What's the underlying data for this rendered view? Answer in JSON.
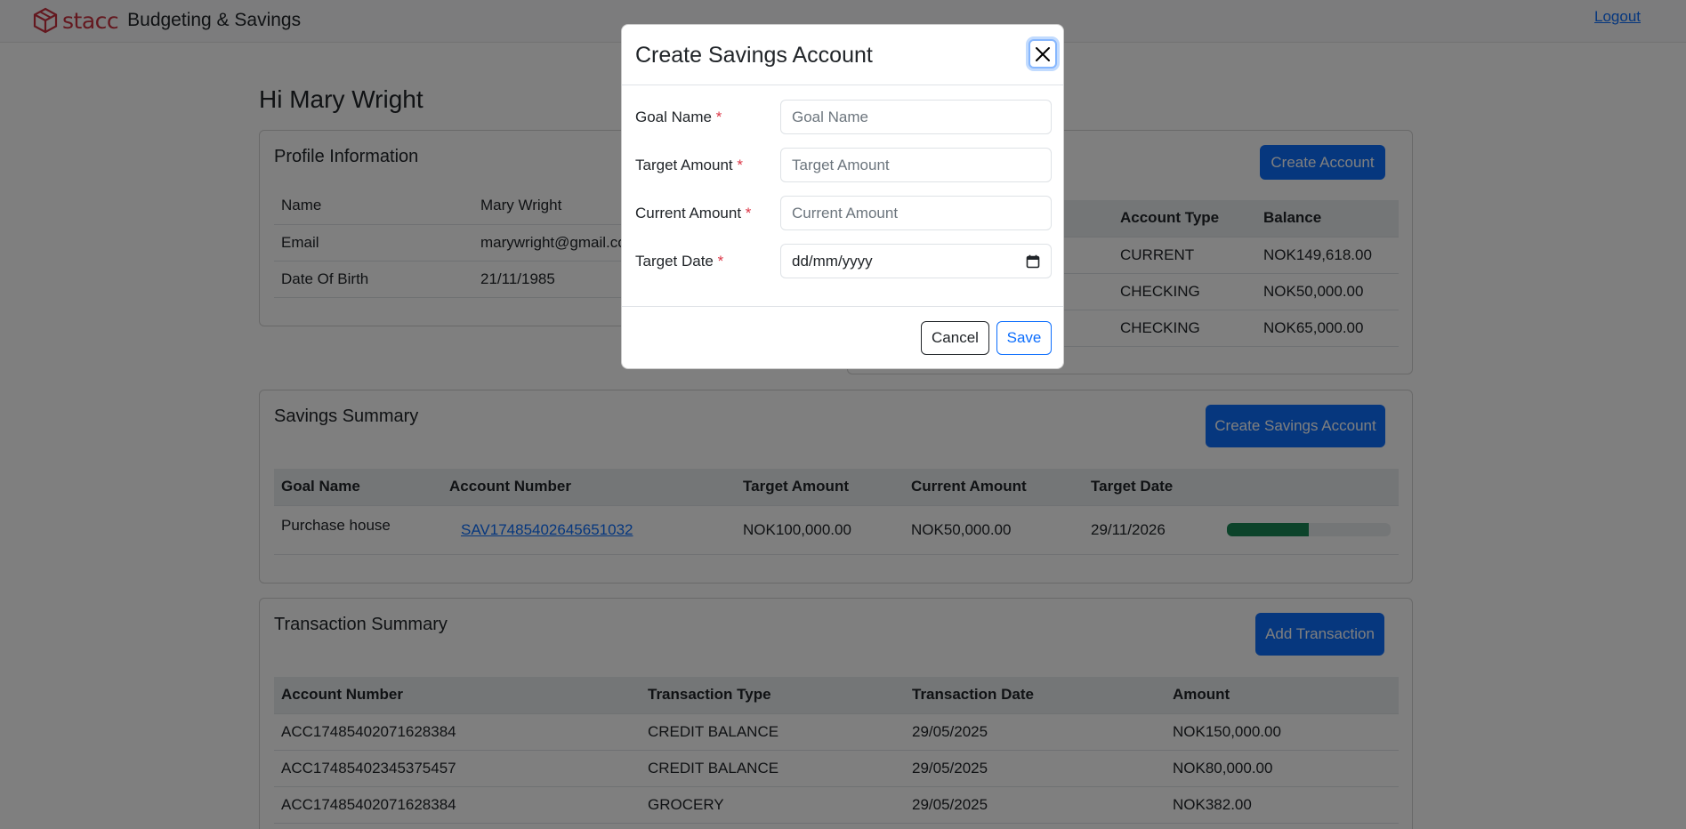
{
  "navbar": {
    "brand_name": "stacc",
    "title": "Budgeting & Savings",
    "logout": "Logout"
  },
  "greeting": "Hi Mary Wright",
  "profile": {
    "title": "Profile Information",
    "rows": [
      {
        "label": "Name",
        "value": "Mary Wright"
      },
      {
        "label": "Email",
        "value": "marywright@gmail.com"
      },
      {
        "label": "Date Of Birth",
        "value": "21/11/1985"
      }
    ]
  },
  "accounts": {
    "create_button": "Create Account",
    "headers": [
      "Account Type",
      "Balance"
    ],
    "rows": [
      {
        "type": "CURRENT",
        "balance": "NOK149,618.00"
      },
      {
        "type": "CHECKING",
        "balance": "NOK50,000.00"
      },
      {
        "type": "CHECKING",
        "balance": "NOK65,000.00"
      }
    ]
  },
  "savings": {
    "title": "Savings Summary",
    "create_button": "Create Savings Account",
    "headers": [
      "Goal Name",
      "Account Number",
      "Target Amount",
      "Current Amount",
      "Target Date",
      ""
    ],
    "rows": [
      {
        "goal": "Purchase house",
        "account": "SAV17485402645651032",
        "target": "NOK100,000.00",
        "current": "NOK50,000.00",
        "date": "29/11/2026",
        "progress": 0.5
      }
    ]
  },
  "transactions": {
    "title": "Transaction Summary",
    "add_button": "Add Transaction",
    "headers": [
      "Account Number",
      "Transaction Type",
      "Transaction Date",
      "Amount"
    ],
    "rows": [
      {
        "account": "ACC17485402071628384",
        "type": "CREDIT BALANCE",
        "date": "29/05/2025",
        "amount": "NOK150,000.00"
      },
      {
        "account": "ACC17485402345375457",
        "type": "CREDIT BALANCE",
        "date": "29/05/2025",
        "amount": "NOK80,000.00"
      },
      {
        "account": "ACC17485402071628384",
        "type": "GROCERY",
        "date": "29/05/2025",
        "amount": "NOK382.00"
      }
    ]
  },
  "modal": {
    "title": "Create Savings Account",
    "fields": {
      "goal_name": {
        "label": "Goal Name",
        "placeholder": "Goal Name"
      },
      "target_amount": {
        "label": "Target Amount",
        "placeholder": "Target Amount"
      },
      "current_amount": {
        "label": "Current Amount",
        "placeholder": "Current Amount"
      },
      "target_date": {
        "label": "Target Date",
        "placeholder": "dd/mm/yyyy"
      }
    },
    "required_mark": "*",
    "cancel": "Cancel",
    "save": "Save"
  },
  "colors": {
    "primary": "#0d6efd",
    "brand": "#c9303f",
    "progress": "#198754",
    "required": "#dc3545"
  }
}
